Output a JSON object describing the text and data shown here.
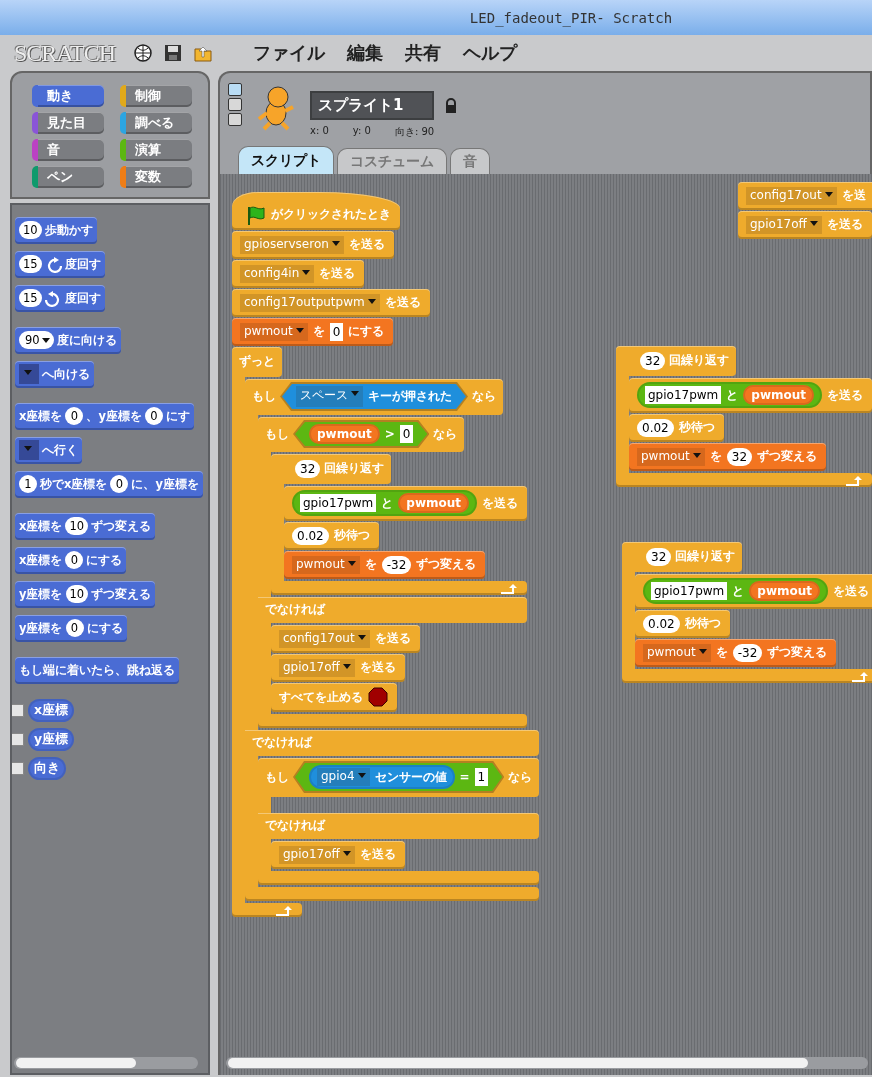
{
  "window": {
    "title": "LED_fadeout_PIR- Scratch"
  },
  "menu_bar": {
    "logo": "SCRATCH",
    "items": [
      "ファイル",
      "編集",
      "共有",
      "ヘルプ"
    ]
  },
  "categories": [
    {
      "label": "動き",
      "color": "#4a6cd4",
      "selected": true
    },
    {
      "label": "制御",
      "color": "#e1a91a",
      "selected": false
    },
    {
      "label": "見た目",
      "color": "#8a55d7",
      "selected": false
    },
    {
      "label": "調べる",
      "color": "#2ca5e2",
      "selected": false
    },
    {
      "label": "音",
      "color": "#bb42c3",
      "selected": false
    },
    {
      "label": "演算",
      "color": "#5cb712",
      "selected": false
    },
    {
      "label": "ペン",
      "color": "#0e9a6c",
      "selected": false
    },
    {
      "label": "変数",
      "color": "#ee7d16",
      "selected": false
    }
  ],
  "palette": [
    [
      {
        "kind": "command",
        "color": "#4a6cd4",
        "parts": [
          {
            "kind": "num",
            "text": "10"
          },
          {
            "kind": "text",
            "text": "歩動かす"
          }
        ]
      },
      {
        "kind": "command",
        "color": "#4a6cd4",
        "parts": [
          {
            "kind": "num",
            "text": "15"
          },
          {
            "kind": "cw"
          },
          {
            "kind": "text",
            "text": "度回す"
          }
        ]
      },
      {
        "kind": "command",
        "color": "#4a6cd4",
        "parts": [
          {
            "kind": "num",
            "text": "15"
          },
          {
            "kind": "ccw"
          },
          {
            "kind": "text",
            "text": "度回す"
          }
        ]
      }
    ],
    [
      {
        "kind": "command",
        "color": "#4a6cd4",
        "parts": [
          {
            "kind": "numdrop",
            "text": "90"
          },
          {
            "kind": "text",
            "text": "度に向ける"
          }
        ]
      },
      {
        "kind": "command",
        "color": "#4a6cd4",
        "parts": [
          {
            "kind": "drop"
          },
          {
            "kind": "text",
            "text": "へ向ける"
          }
        ]
      }
    ],
    [
      {
        "kind": "command",
        "color": "#4a6cd4",
        "parts": [
          {
            "kind": "text",
            "text": "x座標を"
          },
          {
            "kind": "num",
            "text": "0"
          },
          {
            "kind": "text",
            "text": "、y座標を"
          },
          {
            "kind": "num",
            "text": "0"
          },
          {
            "kind": "text",
            "text": "にす"
          }
        ]
      },
      {
        "kind": "command",
        "color": "#4a6cd4",
        "parts": [
          {
            "kind": "drop"
          },
          {
            "kind": "text",
            "text": "へ行く"
          }
        ]
      },
      {
        "kind": "command",
        "color": "#4a6cd4",
        "parts": [
          {
            "kind": "num",
            "text": "1"
          },
          {
            "kind": "text",
            "text": "秒でx座標を"
          },
          {
            "kind": "num",
            "text": "0"
          },
          {
            "kind": "text",
            "text": "に、y座標を"
          }
        ]
      }
    ],
    [
      {
        "kind": "command",
        "color": "#4a6cd4",
        "parts": [
          {
            "kind": "text",
            "text": "x座標を"
          },
          {
            "kind": "num",
            "text": "10"
          },
          {
            "kind": "text",
            "text": "ずつ変える"
          }
        ]
      },
      {
        "kind": "command",
        "color": "#4a6cd4",
        "parts": [
          {
            "kind": "text",
            "text": "x座標を"
          },
          {
            "kind": "num",
            "text": "0"
          },
          {
            "kind": "text",
            "text": "にする"
          }
        ]
      },
      {
        "kind": "command",
        "color": "#4a6cd4",
        "parts": [
          {
            "kind": "text",
            "text": "y座標を"
          },
          {
            "kind": "num",
            "text": "10"
          },
          {
            "kind": "text",
            "text": "ずつ変える"
          }
        ]
      },
      {
        "kind": "command",
        "color": "#4a6cd4",
        "parts": [
          {
            "kind": "text",
            "text": "y座標を"
          },
          {
            "kind": "num",
            "text": "0"
          },
          {
            "kind": "text",
            "text": "にする"
          }
        ]
      }
    ],
    [
      {
        "kind": "command",
        "color": "#4a6cd4",
        "parts": [
          {
            "kind": "text",
            "text": "もし端に着いたら、跳ね返る"
          }
        ]
      }
    ],
    [
      {
        "kind": "monitor",
        "color": "#4a6cd4",
        "checked": false,
        "parts": [
          {
            "kind": "text",
            "text": "x座標"
          }
        ]
      },
      {
        "kind": "monitor",
        "color": "#4a6cd4",
        "checked": false,
        "parts": [
          {
            "kind": "text",
            "text": "y座標"
          }
        ]
      },
      {
        "kind": "monitor",
        "color": "#4a6cd4",
        "checked": false,
        "parts": [
          {
            "kind": "text",
            "text": "向き"
          }
        ]
      }
    ]
  ],
  "sprite": {
    "name": "スプライト1",
    "x": "x: 0",
    "y": "y: 0",
    "direction": "向き: 90",
    "rotation_styles": [
      {
        "selected": true
      },
      {
        "selected": false
      },
      {
        "selected": false
      }
    ]
  },
  "tabs": [
    {
      "label": "スクリプト",
      "selected": true
    },
    {
      "label": "コスチューム",
      "selected": false
    },
    {
      "label": "音",
      "selected": false
    }
  ],
  "scripts": [
    [
      {
        "kind": "hat",
        "color": "#efab2c",
        "parts": [
          {
            "kind": "flag"
          },
          {
            "kind": "text",
            "text": "がクリックされたとき"
          }
        ]
      },
      {
        "kind": "command",
        "color": "#efab2c",
        "parts": [
          {
            "kind": "drop",
            "text": "gpioservseron"
          },
          {
            "kind": "text",
            "text": "を送る"
          }
        ]
      },
      {
        "kind": "command",
        "color": "#efab2c",
        "parts": [
          {
            "kind": "drop",
            "text": "config4in"
          },
          {
            "kind": "text",
            "text": "を送る"
          }
        ]
      },
      {
        "kind": "command",
        "color": "#efab2c",
        "parts": [
          {
            "kind": "drop",
            "text": "config17outputpwm"
          },
          {
            "kind": "text",
            "text": "を送る"
          }
        ]
      },
      {
        "kind": "command",
        "color": "#f37520",
        "parts": [
          {
            "kind": "drop",
            "text": "pwmout"
          },
          {
            "kind": "text",
            "text": "を"
          },
          {
            "kind": "str",
            "text": "0"
          },
          {
            "kind": "text",
            "text": "にする"
          }
        ]
      },
      {
        "kind": "forever",
        "color": "#efab2c",
        "parts": [
          {
            "kind": "text",
            "text": "ずっと"
          }
        ],
        "body": [
          {
            "kind": "ifelse",
            "color": "#efab2c",
            "parts": [
              {
                "kind": "text",
                "text": "もし"
              },
              {
                "kind": "bool",
                "color": "#1f8fdc",
                "parts": [
                  {
                    "kind": "drop",
                    "text": "スペース"
                  },
                  {
                    "kind": "text",
                    "text": "キーが押された"
                  }
                ]
              },
              {
                "kind": "text",
                "text": "なら"
              }
            ],
            "body": [
              {
                "kind": "ifelse",
                "color": "#efab2c",
                "parts": [
                  {
                    "kind": "text",
                    "text": "もし"
                  },
                  {
                    "kind": "bool",
                    "color": "#5cb712",
                    "parts": [
                      {
                        "kind": "var",
                        "text": "pwmout"
                      },
                      {
                        "kind": "text",
                        "text": ">"
                      },
                      {
                        "kind": "str",
                        "text": "0"
                      }
                    ]
                  },
                  {
                    "kind": "text",
                    "text": "なら"
                  }
                ],
                "body": [
                  {
                    "kind": "repeat",
                    "color": "#efab2c",
                    "parts": [
                      {
                        "kind": "num",
                        "text": "32"
                      },
                      {
                        "kind": "text",
                        "text": "回繰り返す"
                      }
                    ],
                    "body": [
                      {
                        "kind": "command",
                        "color": "#efab2c",
                        "parts": [
                          {
                            "kind": "reporter",
                            "color": "#5cb712",
                            "parts": [
                              {
                                "kind": "str",
                                "text": "gpio17pwm"
                              },
                              {
                                "kind": "text",
                                "text": "と"
                              },
                              {
                                "kind": "var",
                                "text": "pwmout"
                              }
                            ]
                          },
                          {
                            "kind": "text",
                            "text": "を送る"
                          }
                        ]
                      },
                      {
                        "kind": "command",
                        "color": "#efab2c",
                        "parts": [
                          {
                            "kind": "num",
                            "text": "0.02"
                          },
                          {
                            "kind": "text",
                            "text": "秒待つ"
                          }
                        ]
                      },
                      {
                        "kind": "command",
                        "color": "#f37520",
                        "parts": [
                          {
                            "kind": "drop",
                            "text": "pwmout"
                          },
                          {
                            "kind": "text",
                            "text": "を"
                          },
                          {
                            "kind": "num",
                            "text": "-32"
                          },
                          {
                            "kind": "text",
                            "text": "ずつ変える"
                          }
                        ]
                      }
                    ]
                  }
                ],
                "else_label": "でなければ",
                "else": [
                  {
                    "kind": "command",
                    "color": "#efab2c",
                    "parts": [
                      {
                        "kind": "drop",
                        "text": "config17out"
                      },
                      {
                        "kind": "text",
                        "text": "を送る"
                      }
                    ]
                  },
                  {
                    "kind": "command",
                    "color": "#efab2c",
                    "parts": [
                      {
                        "kind": "drop",
                        "text": "gpio17off"
                      },
                      {
                        "kind": "text",
                        "text": "を送る"
                      }
                    ]
                  },
                  {
                    "kind": "command",
                    "color": "#efab2c",
                    "parts": [
                      {
                        "kind": "text",
                        "text": "すべてを止める"
                      },
                      {
                        "kind": "stop"
                      }
                    ]
                  }
                ]
              }
            ],
            "else_label": "でなければ",
            "else": [
              {
                "kind": "ifelse",
                "color": "#efab2c",
                "parts": [
                  {
                    "kind": "text",
                    "text": "もし"
                  },
                  {
                    "kind": "bool",
                    "color": "#5cb712",
                    "parts": [
                      {
                        "kind": "reporter",
                        "color": "#1f8fdc",
                        "parts": [
                          {
                            "kind": "drop",
                            "text": "gpio4"
                          },
                          {
                            "kind": "text",
                            "text": "センサーの値"
                          }
                        ]
                      },
                      {
                        "kind": "text",
                        "text": "="
                      },
                      {
                        "kind": "str",
                        "text": "1"
                      }
                    ]
                  },
                  {
                    "kind": "text",
                    "text": "なら"
                  }
                ],
                "else_label": "でなければ",
                "else": [
                  {
                    "kind": "command",
                    "color": "#efab2c",
                    "parts": [
                      {
                        "kind": "drop",
                        "text": "gpio17off"
                      },
                      {
                        "kind": "text",
                        "text": "を送る"
                      }
                    ]
                  }
                ]
              }
            ]
          }
        ]
      }
    ],
    [
      {
        "kind": "command",
        "color": "#efab2c",
        "parts": [
          {
            "kind": "drop",
            "text": "config17out"
          },
          {
            "kind": "text",
            "text": "を送"
          }
        ]
      },
      {
        "kind": "command",
        "color": "#efab2c",
        "parts": [
          {
            "kind": "drop",
            "text": "gpio17off"
          },
          {
            "kind": "text",
            "text": "を送る"
          }
        ]
      }
    ],
    [
      {
        "kind": "repeat",
        "color": "#efab2c",
        "parts": [
          {
            "kind": "num",
            "text": "32"
          },
          {
            "kind": "text",
            "text": "回繰り返す"
          }
        ],
        "body": [
          {
            "kind": "command",
            "color": "#efab2c",
            "parts": [
              {
                "kind": "reporter",
                "color": "#5cb712",
                "parts": [
                  {
                    "kind": "str",
                    "text": "gpio17pwm"
                  },
                  {
                    "kind": "text",
                    "text": "と"
                  },
                  {
                    "kind": "var",
                    "text": "pwmout"
                  }
                ]
              },
              {
                "kind": "text",
                "text": "を送る"
              }
            ]
          },
          {
            "kind": "command",
            "color": "#efab2c",
            "parts": [
              {
                "kind": "num",
                "text": "0.02"
              },
              {
                "kind": "text",
                "text": "秒待つ"
              }
            ]
          },
          {
            "kind": "command",
            "color": "#f37520",
            "parts": [
              {
                "kind": "drop",
                "text": "pwmout"
              },
              {
                "kind": "text",
                "text": "を"
              },
              {
                "kind": "num",
                "text": "32"
              },
              {
                "kind": "text",
                "text": "ずつ変える"
              }
            ]
          }
        ]
      }
    ],
    [
      {
        "kind": "repeat",
        "color": "#efab2c",
        "parts": [
          {
            "kind": "num",
            "text": "32"
          },
          {
            "kind": "text",
            "text": "回繰り返す"
          }
        ],
        "body": [
          {
            "kind": "command",
            "color": "#efab2c",
            "parts": [
              {
                "kind": "reporter",
                "color": "#5cb712",
                "parts": [
                  {
                    "kind": "str",
                    "text": "gpio17pwm"
                  },
                  {
                    "kind": "text",
                    "text": "と"
                  },
                  {
                    "kind": "var",
                    "text": "pwmout"
                  }
                ]
              },
              {
                "kind": "text",
                "text": "を送る"
              }
            ]
          },
          {
            "kind": "command",
            "color": "#efab2c",
            "parts": [
              {
                "kind": "num",
                "text": "0.02"
              },
              {
                "kind": "text",
                "text": "秒待つ"
              }
            ]
          },
          {
            "kind": "command",
            "color": "#f37520",
            "parts": [
              {
                "kind": "drop",
                "text": "pwmout"
              },
              {
                "kind": "text",
                "text": "を"
              },
              {
                "kind": "num",
                "text": "-32"
              },
              {
                "kind": "text",
                "text": "ずつ変える"
              }
            ]
          }
        ]
      }
    ]
  ]
}
